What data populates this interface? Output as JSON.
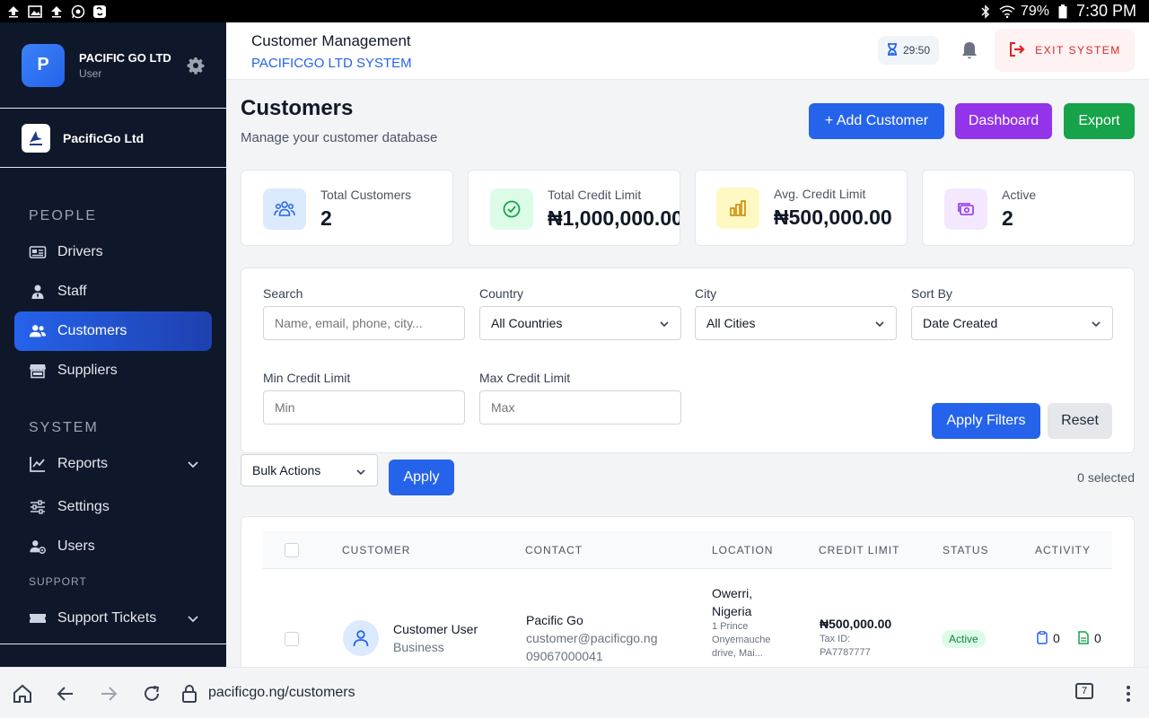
{
  "status_bar": {
    "battery": "79%",
    "time": "7:30 PM"
  },
  "sidebar": {
    "profile": {
      "initial": "P",
      "name": "PACIFIC GO LTD",
      "role": "User"
    },
    "company": {
      "name": "PacificGo Ltd"
    },
    "sections": {
      "people": "PEOPLE",
      "system": "SYSTEM",
      "support": "SUPPORT"
    },
    "items": {
      "drivers": "Drivers",
      "staff": "Staff",
      "customers": "Customers",
      "suppliers": "Suppliers",
      "reports": "Reports",
      "settings": "Settings",
      "users": "Users",
      "support_tickets": "Support Tickets"
    }
  },
  "header": {
    "title": "Customer Management",
    "subtitle": "PACIFICGO LTD SYSTEM",
    "timer": "29:50",
    "exit_label": "EXIT SYSTEM"
  },
  "page": {
    "title": "Customers",
    "subtitle": "Manage your customer database",
    "add_button": "+ Add Customer",
    "dashboard_button": "Dashboard",
    "export_button": "Export"
  },
  "stats": [
    {
      "label": "Total Customers",
      "value": "2"
    },
    {
      "label": "Total Credit Limit",
      "value": "₦1,000,000.00"
    },
    {
      "label": "Avg. Credit Limit",
      "value": "₦500,000.00"
    },
    {
      "label": "Active",
      "value": "2"
    }
  ],
  "filters": {
    "search_label": "Search",
    "search_placeholder": "Name, email, phone, city...",
    "country_label": "Country",
    "country_value": "All Countries",
    "city_label": "City",
    "city_value": "All Cities",
    "sort_label": "Sort By",
    "sort_value": "Date Created",
    "min_label": "Min Credit Limit",
    "min_placeholder": "Min",
    "max_label": "Max Credit Limit",
    "max_placeholder": "Max",
    "apply_label": "Apply Filters",
    "reset_label": "Reset"
  },
  "bulk": {
    "select_value": "Bulk Actions",
    "apply_label": "Apply",
    "selected_text": "0 selected"
  },
  "table": {
    "headers": [
      "CUSTOMER",
      "CONTACT",
      "LOCATION",
      "CREDIT LIMIT",
      "STATUS",
      "ACTIVITY"
    ],
    "rows": [
      {
        "name": "Customer User",
        "type": "Business",
        "contact_name": "Pacific Go",
        "email": "customer@pacificgo.ng",
        "phone": "09067000041",
        "city": "Owerri,",
        "country": "Nigeria",
        "address": "1 Prince Onyemauche drive, Mai...",
        "credit_limit": "₦500,000.00",
        "tax_id": "Tax ID: PA7787777",
        "status": "Active",
        "activity_a": "0",
        "activity_b": "0"
      }
    ]
  },
  "browser": {
    "url": "pacificgo.ng/customers",
    "tab_count": "7"
  }
}
